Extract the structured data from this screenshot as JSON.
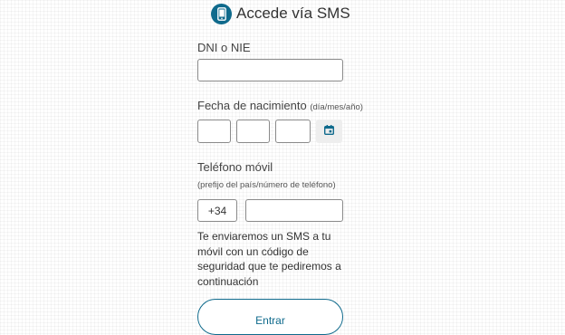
{
  "header": {
    "icon": "mobile-phone-icon",
    "title": "Accede vía SMS"
  },
  "dni": {
    "label": "DNI o NIE",
    "value": ""
  },
  "birthdate": {
    "label": "Fecha de nacimiento",
    "hint": "(día/mes/año)",
    "day": "",
    "month": "",
    "year": "",
    "calendar_icon": "calendar-icon"
  },
  "phone": {
    "label": "Teléfono móvil",
    "hint": "(prefijo del país/número de teléfono)",
    "prefix": "+34",
    "number": ""
  },
  "info_text": "Te enviaremos un SMS a tu móvil con un código de seguridad que te pediremos a continuación",
  "submit_label": "Entrar",
  "colors": {
    "accent": "#0f6a8c",
    "input_border": "#8a8a8a",
    "text": "#333333"
  }
}
